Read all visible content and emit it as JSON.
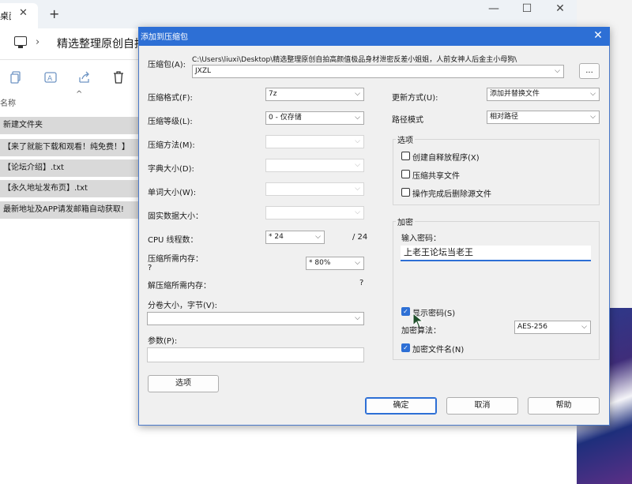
{
  "explorer": {
    "tab_title": "桌面",
    "tab_close": "✕",
    "new_tab": "+",
    "window_controls": {
      "minimize": "—",
      "maximize": "☐",
      "close": "✕"
    },
    "address_chevron": "›",
    "address_path": "精选整理原创自拍",
    "toolbar_icons": [
      "copy-icon",
      "rename-icon",
      "share-icon",
      "delete-icon"
    ],
    "sort_indicator": "^",
    "column_header": "名称",
    "files": [
      "新建文件夹",
      "【来了就能下载和观看！纯免费！】",
      "【论坛介绍】.txt",
      "【永久地址发布页】.txt",
      "最新地址及APP请发邮箱自动获取!"
    ]
  },
  "dialog": {
    "title": "添加到压缩包",
    "close": "✕",
    "archive_label": "压缩包(A):",
    "archive_path": "C:\\Users\\liuxi\\Desktop\\精选整理原创自拍高颜值极品身材泄密反差小姐姐，人前女神人后金主小母狗\\",
    "archive_name": "JXZL",
    "browse_button": "...",
    "format_label": "压缩格式(F):",
    "format_value": "7z",
    "level_label": "压缩等级(L):",
    "level_value": "0 - 仅存储",
    "method_label": "压缩方法(M):",
    "dict_label": "字典大小(D):",
    "word_label": "单词大小(W):",
    "solid_label": "固实数据大小：",
    "cpu_label": "CPU 线程数：",
    "cpu_value": "* 24",
    "cpu_total": "/ 24",
    "mem_label": "压缩所需内存：",
    "mem_sub": "?",
    "mem_value": "* 80%",
    "decomp_label": "解压缩所需内存：",
    "decomp_value": "?",
    "volume_label": "分卷大小，字节(V):",
    "params_label": "参数(P):",
    "options_button": "选项",
    "update_label": "更新方式(U):",
    "update_value": "添加并替换文件",
    "path_label": "路径模式",
    "path_value": "相对路径",
    "options_group": "选项",
    "opt_sfx": "创建自释放程序(X)",
    "opt_shared": "压缩共享文件",
    "opt_delete": "操作完成后删除源文件",
    "encrypt_group": "加密",
    "password_label": "输入密码：",
    "password_value": "上老王论坛当老王",
    "show_password": "显示密码(S)",
    "enc_method_label": "加密算法：",
    "enc_method_value": "AES-256",
    "encrypt_names": "加密文件名(N)",
    "ok_button": "确定",
    "cancel_button": "取消",
    "help_button": "帮助"
  },
  "colors": {
    "accent": "#2d6fd5",
    "dialog_bg": "#f0f0f0",
    "file_row_bg": "#d9d9d9"
  }
}
